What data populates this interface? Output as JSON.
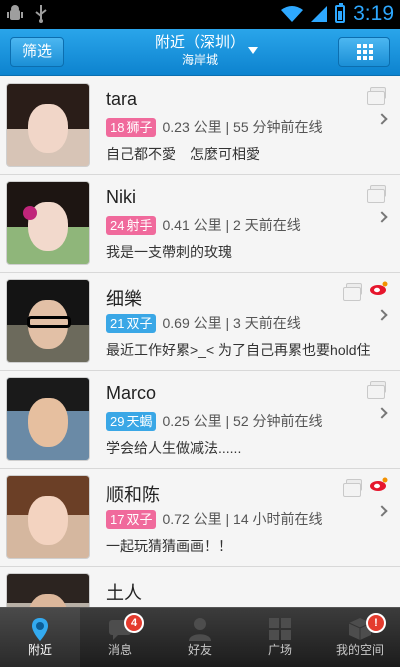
{
  "status_bar": {
    "time": "3:19"
  },
  "nav": {
    "filter_label": "筛选",
    "title": "附近（深圳）",
    "subtitle": "海岸城"
  },
  "users": [
    {
      "name": "tara",
      "age": "18",
      "sign": "狮子",
      "gender": "f",
      "distance": "0.23 公里 | 55 分钟前在线",
      "signature": "自己都不愛　怎麼可相愛",
      "weibo": false
    },
    {
      "name": "Niki",
      "age": "24",
      "sign": "射手",
      "gender": "f",
      "distance": "0.41 公里 | 2 天前在线",
      "signature": "我是一支帶刺的玫瑰",
      "weibo": false
    },
    {
      "name": "细樂",
      "age": "21",
      "sign": "双子",
      "gender": "m",
      "distance": "0.69 公里 | 3 天前在线",
      "signature": "最近工作好累>_< 为了自己再累也要hold住",
      "weibo": true
    },
    {
      "name": "Marco",
      "age": "29",
      "sign": "天蝎",
      "gender": "m",
      "distance": "0.25 公里 | 52 分钟前在线",
      "signature": "学会给人生做减法......",
      "weibo": false
    },
    {
      "name": "顺和陈",
      "age": "17",
      "sign": "双子",
      "gender": "f",
      "distance": "0.72 公里 | 14 小时前在线",
      "signature": "一起玩猜猜画画！！",
      "weibo": true
    },
    {
      "name": "土人",
      "age": "",
      "sign": "",
      "gender": "m",
      "distance": "",
      "signature": "",
      "weibo": false
    }
  ],
  "tabs": [
    {
      "label": "附近",
      "badge": ""
    },
    {
      "label": "消息",
      "badge": "4"
    },
    {
      "label": "好友",
      "badge": ""
    },
    {
      "label": "广场",
      "badge": ""
    },
    {
      "label": "我的空间",
      "badge": "!"
    }
  ],
  "colors": {
    "accent": "#1a90d8",
    "female_badge": "#f06a9c",
    "male_badge": "#3aa7e6",
    "alert": "#e43b2e"
  }
}
